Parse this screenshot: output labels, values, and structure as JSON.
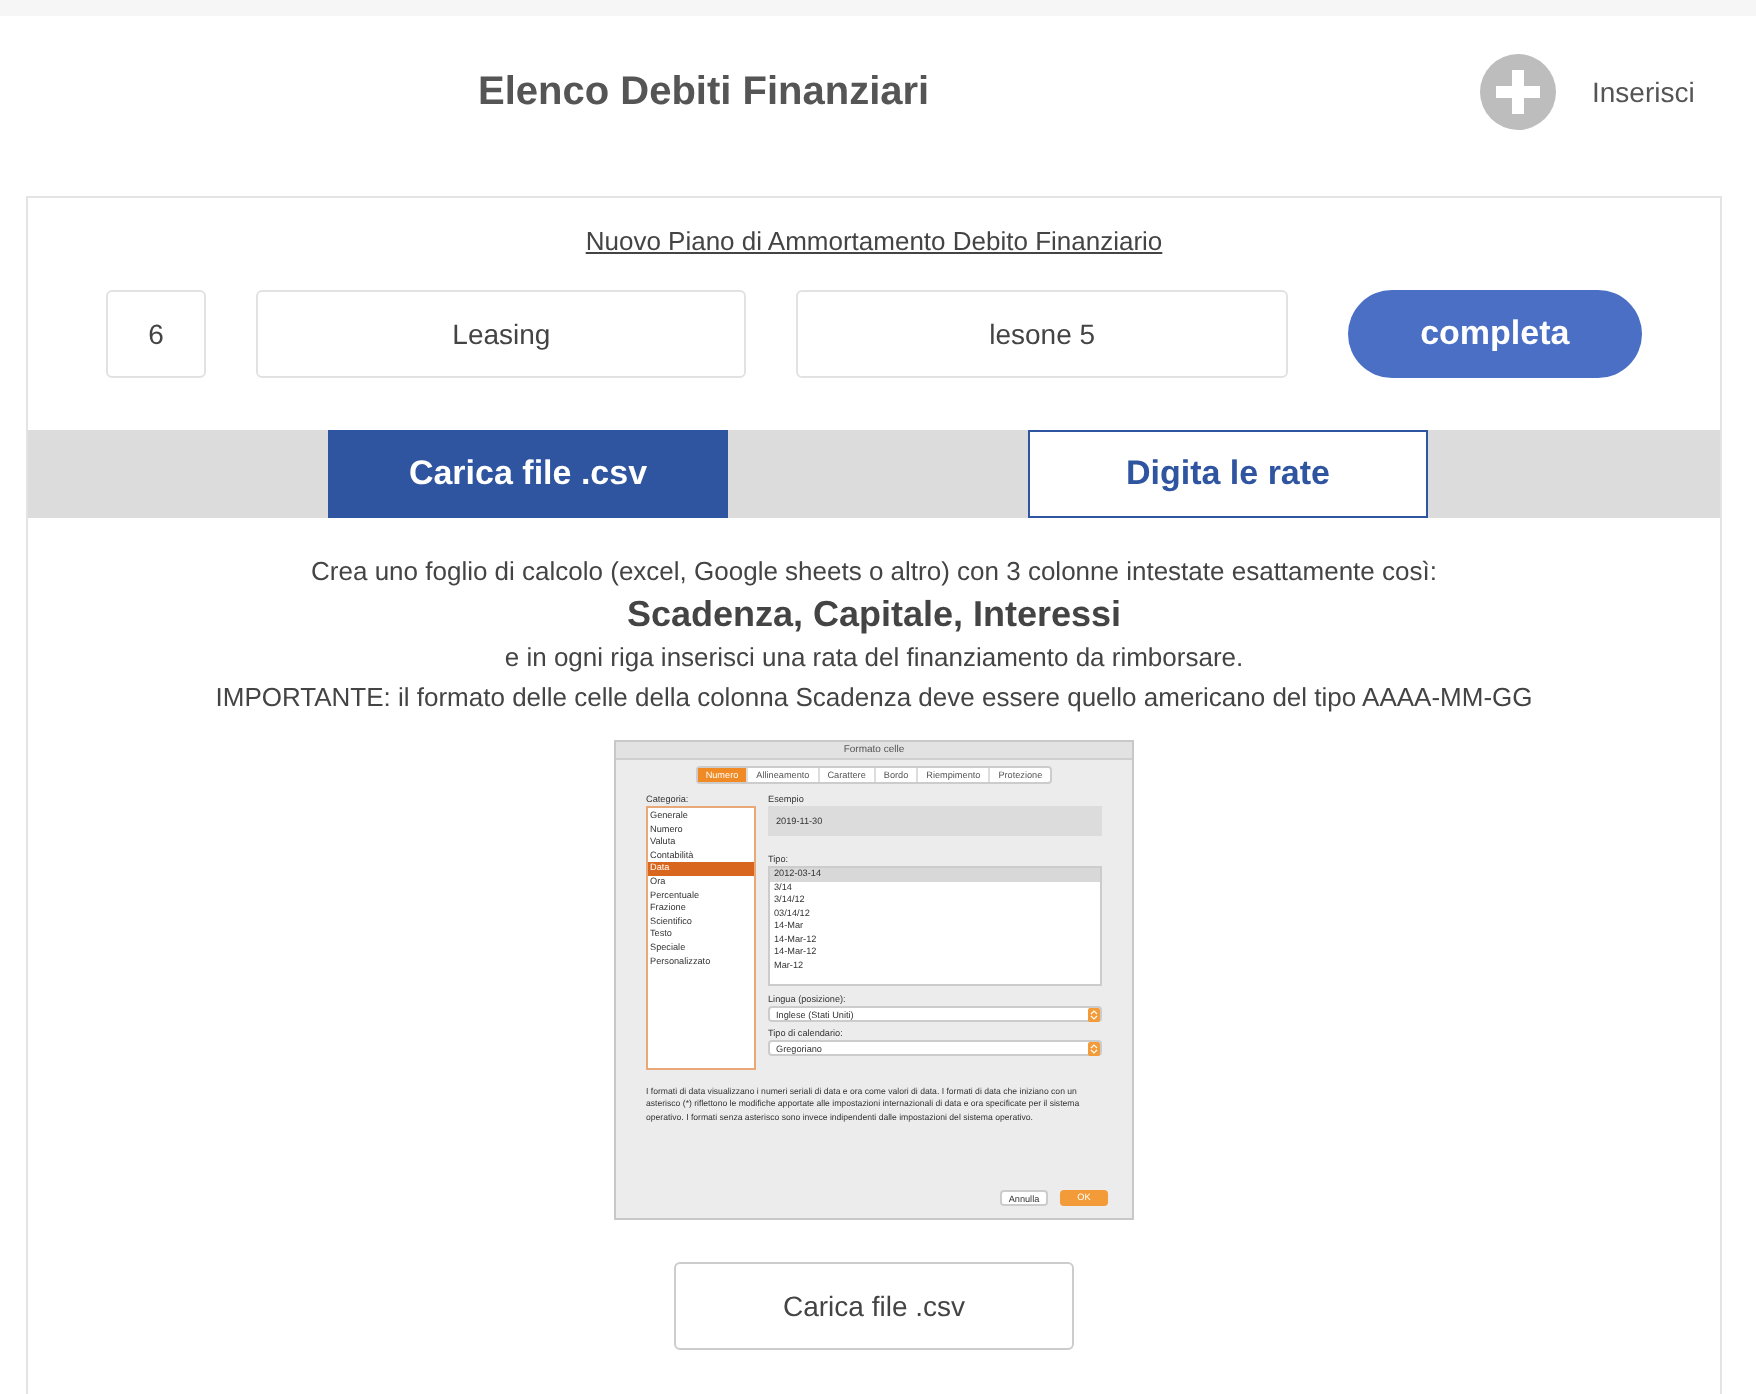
{
  "header": {
    "title": "Elenco Debiti Finanziari",
    "add_label": "Inserisci"
  },
  "form": {
    "title": "Nuovo Piano di Ammortamento Debito Finanziario",
    "fields": [
      {
        "value": "6"
      },
      {
        "value": "Leasing"
      },
      {
        "value": "lesone 5"
      }
    ],
    "submit": "completa"
  },
  "tabs": [
    {
      "label": "Carica file .csv",
      "selected": true
    },
    {
      "label": "Digita le rate",
      "selected": false
    }
  ],
  "instructions": {
    "intro": "Crea uno foglio di calcolo  (excel, Google sheets o altro) con 3 colonne intestate esattamente così:",
    "columns": "Scadenza, Capitale, Interessi",
    "rows": "e in ogni riga inserisci una rata del finanziamento da rimborsare.",
    "important": "IMPORTANTE: il formato delle celle della colonna Scadenza deve essere quello americano del tipo AAAA-MM-GG"
  },
  "example_dialog": {
    "title": "Formato celle",
    "tabs": [
      {
        "label": "Numero",
        "selected": true
      },
      {
        "label": "Allineamento",
        "selected": false
      },
      {
        "label": "Carattere",
        "selected": false
      },
      {
        "label": "Bordo",
        "selected": false
      },
      {
        "label": "Riempimento",
        "selected": false
      },
      {
        "label": "Protezione",
        "selected": false
      }
    ],
    "category_label": "Categoria:",
    "categories": [
      {
        "label": "Generale",
        "selected": false
      },
      {
        "label": "Numero",
        "selected": false
      },
      {
        "label": "Valuta",
        "selected": false
      },
      {
        "label": "Contabilità",
        "selected": false
      },
      {
        "label": "Data",
        "selected": true
      },
      {
        "label": "Ora",
        "selected": false
      },
      {
        "label": "Percentuale",
        "selected": false
      },
      {
        "label": "Frazione",
        "selected": false
      },
      {
        "label": "Scientifico",
        "selected": false
      },
      {
        "label": "Testo",
        "selected": false
      },
      {
        "label": "Speciale",
        "selected": false
      },
      {
        "label": "Personalizzato",
        "selected": false
      }
    ],
    "example_label": "Esempio",
    "example_value": "2019-11-30",
    "type_label": "Tipo:",
    "types": [
      {
        "label": "2012-03-14",
        "selected": true
      },
      {
        "label": "3/14",
        "selected": false
      },
      {
        "label": "3/14/12",
        "selected": false
      },
      {
        "label": "03/14/12",
        "selected": false
      },
      {
        "label": "14-Mar",
        "selected": false
      },
      {
        "label": "14-Mar-12",
        "selected": false
      },
      {
        "label": "14-Mar-12",
        "selected": false
      },
      {
        "label": "Mar-12",
        "selected": false
      }
    ],
    "language_label": "Lingua (posizione):",
    "language_value": "Inglese (Stati Uniti)",
    "calendar_label": "Tipo di calendario:",
    "calendar_value": "Gregoriano",
    "note": "I formati di data visualizzano i numeri seriali di data e ora come valori di data. I formati di data che iniziano con un asterisco (*) riflettono le modifiche apportate alle impostazioni internazionali di data e ora specificate per il sistema operativo. I formati senza asterisco sono invece indipendenti dalle impostazioni del sistema operativo.",
    "buttons": [
      {
        "label": "Annulla",
        "kind": "secondary"
      },
      {
        "label": "OK",
        "kind": "primary"
      }
    ]
  },
  "upload_button": {
    "label": "Carica file .csv"
  }
}
